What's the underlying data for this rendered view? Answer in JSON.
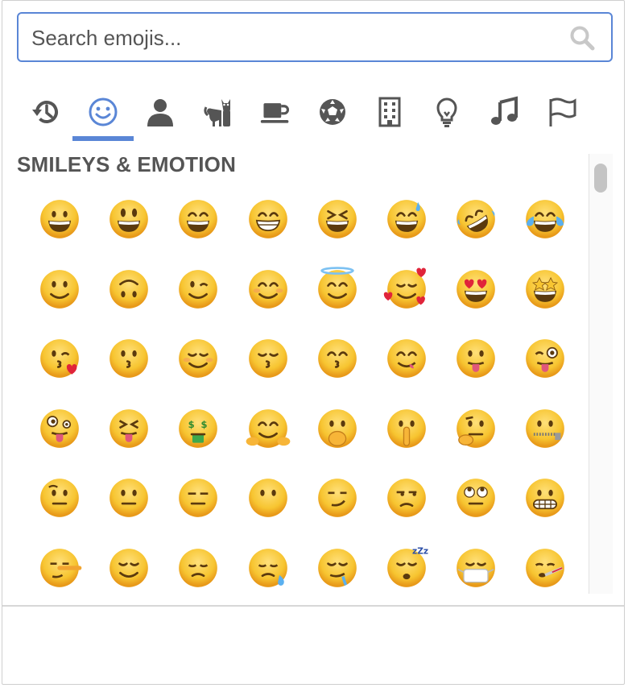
{
  "search": {
    "placeholder": "Search emojis...",
    "value": ""
  },
  "tabs": [
    {
      "name": "recent",
      "icon": "clock-history-icon",
      "active": false
    },
    {
      "name": "smileys",
      "icon": "smiley-icon",
      "active": true
    },
    {
      "name": "people",
      "icon": "person-icon",
      "active": false
    },
    {
      "name": "animals",
      "icon": "cat-icon",
      "active": false
    },
    {
      "name": "food",
      "icon": "coffee-cup-icon",
      "active": false
    },
    {
      "name": "activities",
      "icon": "soccer-ball-icon",
      "active": false
    },
    {
      "name": "travel",
      "icon": "building-icon",
      "active": false
    },
    {
      "name": "objects",
      "icon": "lightbulb-icon",
      "active": false
    },
    {
      "name": "symbols",
      "icon": "music-note-icon",
      "active": false
    },
    {
      "name": "flags",
      "icon": "flag-icon",
      "active": false
    }
  ],
  "accent_color": "#5a86d6",
  "section": {
    "title": "SMILEYS & EMOTION"
  },
  "emoji_rows": [
    [
      "grinning-face",
      "grinning-face-big-eyes",
      "grinning-face-smiling-eyes",
      "beaming-face",
      "grinning-squinting-face",
      "grinning-face-sweat",
      "rolling-on-floor-laughing",
      "face-tears-of-joy"
    ],
    [
      "slightly-smiling-face",
      "upside-down-face",
      "winking-face",
      "smiling-face-smiling-eyes",
      "smiling-face-halo",
      "smiling-face-hearts",
      "heart-eyes-face",
      "star-struck"
    ],
    [
      "face-blowing-kiss",
      "kissing-face",
      "smiling-face",
      "kissing-face-closed-eyes",
      "kissing-face-smiling-eyes",
      "face-savoring-food",
      "face-with-tongue",
      "winking-face-tongue"
    ],
    [
      "zany-face",
      "squinting-face-tongue",
      "money-mouth-face",
      "hugging-face",
      "face-hand-over-mouth",
      "shushing-face",
      "thinking-face",
      "zipper-mouth-face"
    ],
    [
      "face-raised-eyebrow",
      "neutral-face",
      "expressionless-face",
      "face-without-mouth",
      "smirking-face",
      "unamused-face",
      "face-rolling-eyes",
      "grimacing-face"
    ],
    [
      "lying-face",
      "relieved-face",
      "pensive-face",
      "sleepy-face",
      "drooling-face",
      "sleeping-face",
      "face-medical-mask",
      "face-thermometer"
    ]
  ]
}
